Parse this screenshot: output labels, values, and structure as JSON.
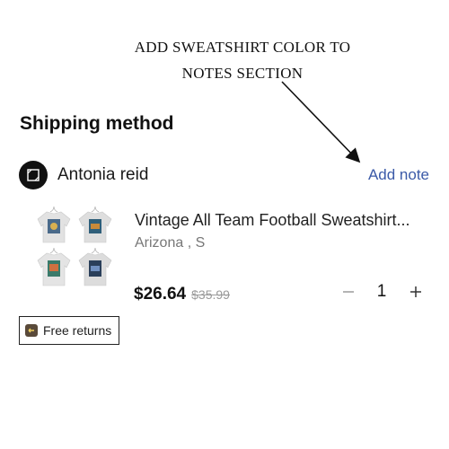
{
  "annotation": {
    "line1": "ADD SWEATSHIRT  COLOR TO",
    "line2": "NOTES  SECTION"
  },
  "shipping": {
    "title": "Shipping method"
  },
  "seller": {
    "name": "Antonia reid",
    "add_note_label": "Add note",
    "add_note_color": "#3b5aa8"
  },
  "product": {
    "title": "Vintage All Team Football Sweatshirt...",
    "variant": "Arizona , S",
    "price": "$26.64",
    "original_price": "$35.99",
    "quantity": "1",
    "minus_icon": "minus-icon",
    "plus_icon": "plus-icon"
  },
  "badge": {
    "free_returns_label": "Free returns",
    "icon": "return-icon"
  }
}
